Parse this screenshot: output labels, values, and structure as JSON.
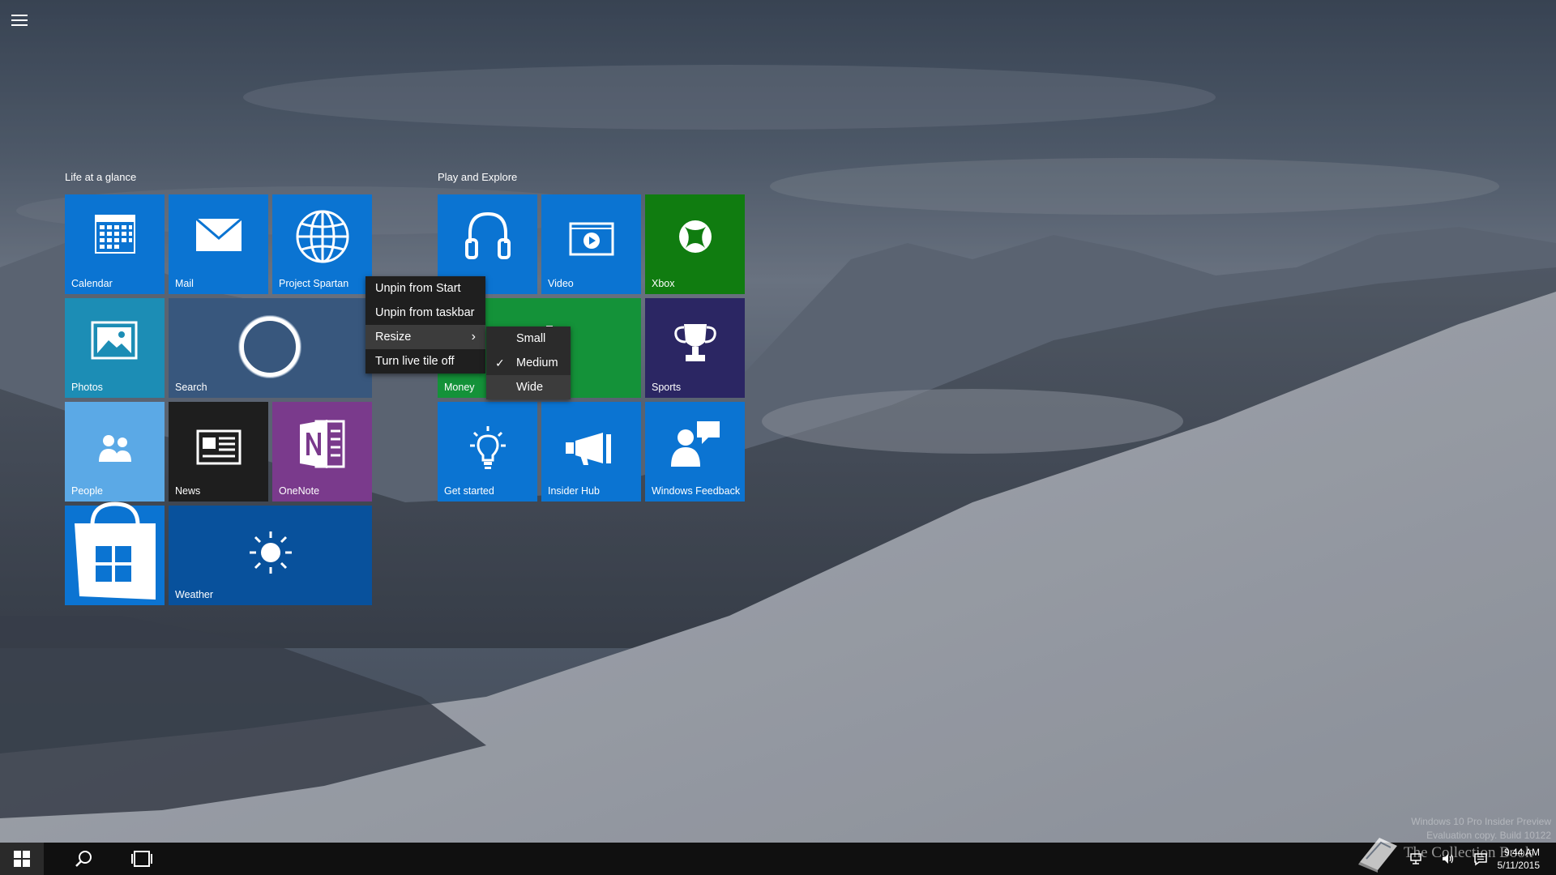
{
  "groups": [
    {
      "title": "Life at a glance"
    },
    {
      "title": "Play and Explore"
    }
  ],
  "tiles": {
    "calendar": {
      "label": "Calendar",
      "color": "#0b74d2",
      "icon": "calendar-icon"
    },
    "mail": {
      "label": "Mail",
      "color": "#0b74d2",
      "icon": "mail-icon"
    },
    "spartan": {
      "label": "Project Spartan",
      "color": "#0b74d2",
      "icon": "globe-icon"
    },
    "photos": {
      "label": "Photos",
      "color": "#1c8db5",
      "icon": "photos-icon"
    },
    "search": {
      "label": "Search",
      "color": "#38577d",
      "icon": "cortana-ring-icon"
    },
    "people": {
      "label": "People",
      "color": "#5ba9e6",
      "icon": "people-icon"
    },
    "news": {
      "label": "News",
      "color": "#1e1e1e",
      "icon": "news-icon"
    },
    "onenote": {
      "label": "OneNote",
      "color": "#7a3a8c",
      "icon": "onenote-icon"
    },
    "store": {
      "label": "",
      "color": "#0b74d2",
      "icon": "store-bag-icon"
    },
    "weather": {
      "label": "Weather",
      "color": "#08519c",
      "icon": "sun-icon"
    },
    "music": {
      "label": "",
      "color": "#0b74d2",
      "icon": "headphones-icon"
    },
    "video": {
      "label": "Video",
      "color": "#0b74d2",
      "icon": "video-icon"
    },
    "xbox": {
      "label": "Xbox",
      "color": "#107c10",
      "icon": "xbox-icon"
    },
    "money": {
      "label": "Money",
      "color": "#149239",
      "icon": "money-icon"
    },
    "sports": {
      "label": "Sports",
      "color": "#2b2663",
      "icon": "trophy-icon"
    },
    "getstarted": {
      "label": "Get started",
      "color": "#0b74d2",
      "icon": "lightbulb-icon"
    },
    "insiderhub": {
      "label": "Insider Hub",
      "color": "#0b74d2",
      "icon": "megaphone-icon"
    },
    "feedback": {
      "label": "Windows Feedback",
      "color": "#0b74d2",
      "icon": "feedback-icon"
    }
  },
  "context_menu": {
    "items": [
      "Unpin from Start",
      "Unpin from taskbar",
      "Resize",
      "Turn live tile off"
    ],
    "resize_submenu": [
      "Small",
      "Medium",
      "Wide"
    ],
    "checked": "Medium"
  },
  "watermark": {
    "line1": "Windows 10 Pro Insider Preview",
    "line2": "Evaluation copy. Build 10122"
  },
  "brand": {
    "text": "The Collection Book"
  },
  "clock": {
    "time": "9:44 AM",
    "date": "5/11/2015"
  }
}
